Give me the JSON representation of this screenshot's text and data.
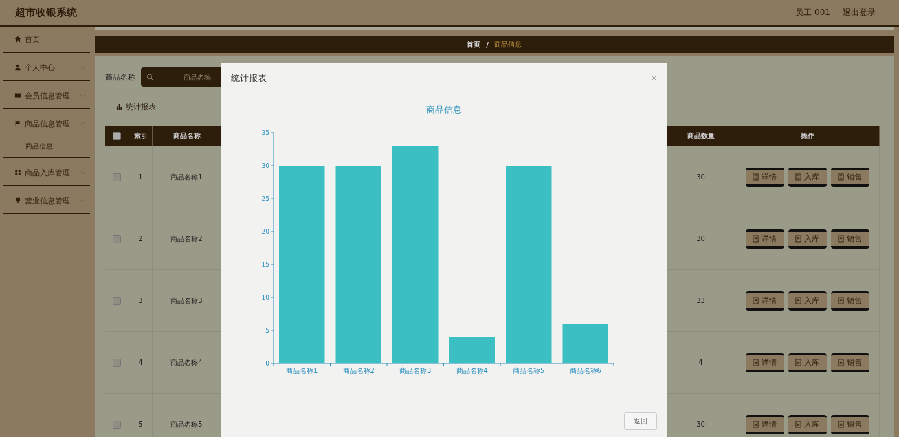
{
  "header": {
    "title": "超市收银系统",
    "user": "员工 001",
    "logout": "退出登录"
  },
  "sidebar": {
    "items": [
      {
        "label": "首页",
        "kind": "link"
      },
      {
        "label": "个人中心",
        "kind": "menu",
        "expanded": false
      },
      {
        "label": "会员信息管理",
        "kind": "menu",
        "expanded": false
      },
      {
        "label": "商品信息管理",
        "kind": "menu",
        "expanded": true,
        "children": [
          {
            "label": "商品信息"
          }
        ]
      },
      {
        "label": "商品入库管理",
        "kind": "menu",
        "expanded": false
      },
      {
        "label": "营业信息管理",
        "kind": "menu",
        "expanded": false
      }
    ]
  },
  "breadcrumb": {
    "separator": "/",
    "items": [
      {
        "label": "首页",
        "selected": false
      },
      {
        "label": "商品信息",
        "selected": true
      }
    ]
  },
  "filter": {
    "label": "商品名称",
    "placeholder": "商品名称"
  },
  "toolbar": {
    "report_button": "统计报表"
  },
  "table": {
    "header_checked": false,
    "columns": [
      "索引",
      "商品名称",
      "商品数量",
      "操作"
    ],
    "rows": [
      {
        "checked": false,
        "index": "1",
        "name": "商品名称1",
        "quantity": "30",
        "actions": [
          "详情",
          "入库",
          "销售"
        ]
      },
      {
        "checked": false,
        "index": "2",
        "name": "商品名称2",
        "quantity": "30",
        "actions": [
          "详情",
          "入库",
          "销售"
        ]
      },
      {
        "checked": false,
        "index": "3",
        "name": "商品名称3",
        "quantity": "33",
        "actions": [
          "详情",
          "入库",
          "销售"
        ]
      },
      {
        "checked": false,
        "index": "4",
        "name": "商品名称4",
        "quantity": "4",
        "actions": [
          "详情",
          "入库",
          "销售"
        ]
      },
      {
        "checked": false,
        "index": "5",
        "name": "商品名称5",
        "quantity": "30",
        "actions": [
          "详情",
          "入库",
          "销售"
        ]
      }
    ]
  },
  "modal": {
    "title": "统计报表",
    "back_button": "返回",
    "chart_data": {
      "type": "bar",
      "title": "商品信息",
      "categories": [
        "商品名称1",
        "商品名称2",
        "商品名称3",
        "商品名称4",
        "商品名称5",
        "商品名称6"
      ],
      "series": [
        {
          "color": "#3bbfc2",
          "values": [
            30,
            30,
            33,
            4,
            30,
            6
          ]
        }
      ],
      "ylim": [
        0,
        35
      ],
      "yticks": [
        0,
        5,
        10,
        15,
        20,
        25,
        30,
        35
      ]
    }
  }
}
